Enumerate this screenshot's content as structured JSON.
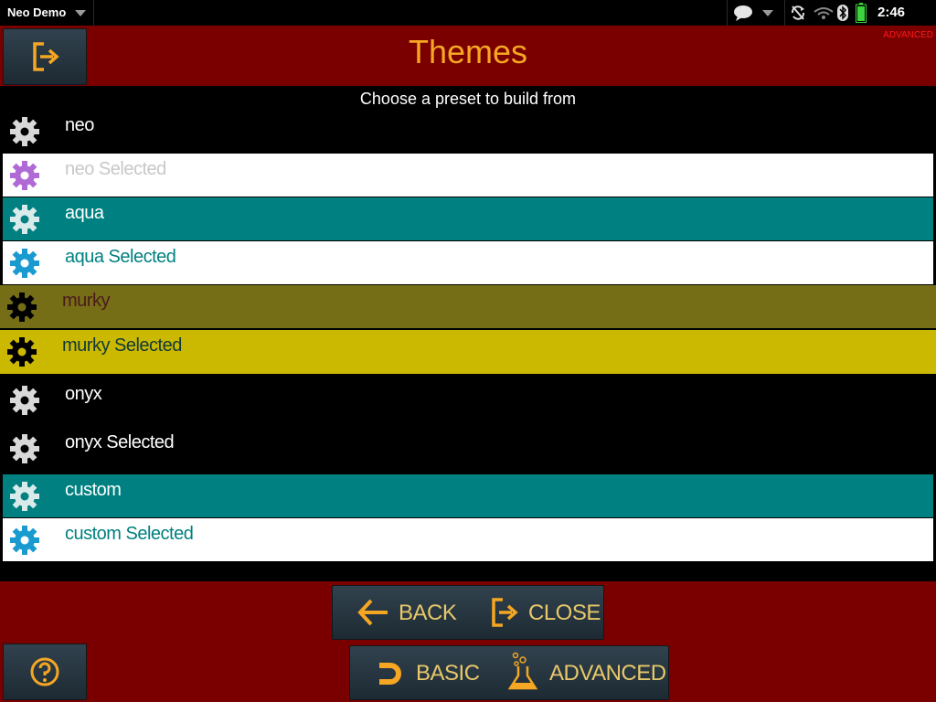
{
  "status_bar": {
    "app_name": "Neo Demo",
    "time": "2:46"
  },
  "header": {
    "title": "Themes",
    "mode_tag": "ADVANCED"
  },
  "subtitle": "Choose a preset to build from",
  "themes": [
    {
      "label": "neo",
      "bg": "#000000",
      "text_color": "#ffffff",
      "gear_color": "#d8d8d8"
    },
    {
      "label": "neo Selected",
      "bg": "#ffffff",
      "text_color": "#c8c8c8",
      "gear_color": "#b06ad6"
    },
    {
      "label": "aqua",
      "bg": "#008080",
      "text_color": "#ffffff",
      "gear_color": "#d8eaea"
    },
    {
      "label": "aqua Selected",
      "bg": "#ffffff",
      "text_color": "#008080",
      "gear_color": "#1a9bd0"
    },
    {
      "label": "murky",
      "bg": "#766e17",
      "text_color": "#4a1a1a",
      "gear_color": "#000000"
    },
    {
      "label": "murky Selected",
      "bg": "#cbb800",
      "text_color": "#113a3a",
      "gear_color": "#000000"
    },
    {
      "label": "onyx",
      "bg": "#000000",
      "text_color": "#ffffff",
      "gear_color": "#d8d8d8"
    },
    {
      "label": "onyx Selected",
      "bg": "#000000",
      "text_color": "#ffffff",
      "gear_color": "#d8d8d8"
    },
    {
      "label": "custom",
      "bg": "#008080",
      "text_color": "#ffffff",
      "gear_color": "#d8eaea"
    },
    {
      "label": "custom Selected",
      "bg": "#ffffff",
      "text_color": "#008080",
      "gear_color": "#1a9bd0"
    }
  ],
  "footer": {
    "back_label": "BACK",
    "close_label": "CLOSE",
    "basic_label": "BASIC",
    "advanced_label": "ADVANCED"
  },
  "colors": {
    "header_bg": "#7a0000",
    "accent": "#f5a623",
    "button_text": "#e8c86a"
  }
}
